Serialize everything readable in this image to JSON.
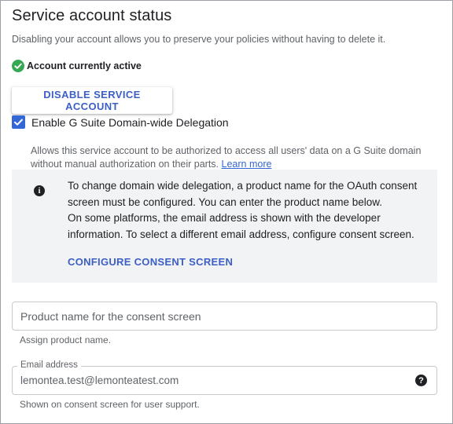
{
  "header": {
    "title": "Service account status",
    "description": "Disabling your account allows you to preserve your policies without having to delete it."
  },
  "status": {
    "icon": "check-circle-icon",
    "label": "Account currently active",
    "color": "#34a853"
  },
  "disable_button": {
    "label": "DISABLE SERVICE ACCOUNT"
  },
  "delegation": {
    "checked": true,
    "label": "Enable G Suite Domain-wide Delegation",
    "help_text": "Allows this service account to be authorized to access all users' data on a G Suite domain without manual authorization on their parts.",
    "learn_more": "Learn more"
  },
  "info": {
    "icon": "info-icon",
    "line1": "To change domain wide delegation, a product name for the OAuth consent screen must be configured. You can enter the product name below.",
    "line2": "On some platforms, the email address is shown with the developer information. To select a different email address, configure consent screen.",
    "link": "CONFIGURE CONSENT SCREEN"
  },
  "product_name": {
    "placeholder": "Product name for the consent screen",
    "value": "",
    "hint": "Assign product name."
  },
  "email": {
    "label": "Email address",
    "value": "lemontea.test@lemonteatest.com",
    "help_icon": "help-icon",
    "hint": "Shown on consent screen for user support."
  },
  "colors": {
    "accent": "#3367d6",
    "button_text": "#3c5fc6",
    "info_bg": "#f1f3f4"
  }
}
